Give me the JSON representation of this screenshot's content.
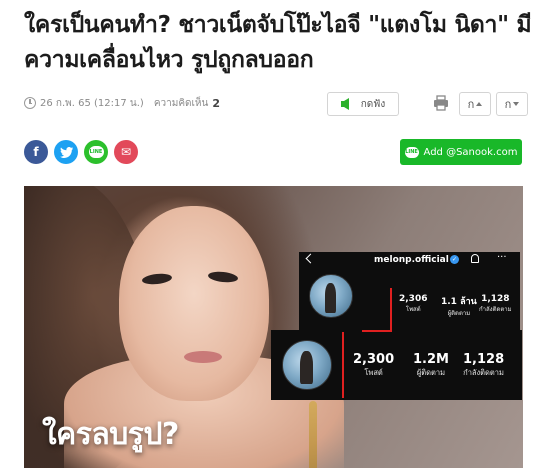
{
  "article": {
    "title": "ใครเป็นคนทำ? ชาวเน็ตจับโป๊ะไอจี \"แตงโม นิดา\" มีความเคลื่อนไหว รูปถูกลบออก",
    "date": "26 ก.พ. 65 (12:17 น.)",
    "comment_label": "ความคิดเห็น",
    "comment_count": "2"
  },
  "toolbar": {
    "listen_label": "กดฟัง",
    "font_up_label": "ก",
    "font_down_label": "ก"
  },
  "share": {
    "facebook": "f",
    "twitter": "t",
    "line": "LINE",
    "mail": "✉",
    "add_label": "Add @Sanook.com",
    "line_icon_text": "LINE"
  },
  "hero": {
    "caption": "ใครลบรูป?",
    "ig_top": {
      "username": "melonp.official",
      "posts": "2,306",
      "posts_label": "โพสต์",
      "followers": "1.1 ล้าน",
      "followers_label": "ผู้ติดตาม",
      "following": "1,128",
      "following_label": "กำลังติดตาม"
    },
    "ig_bottom": {
      "posts": "2,300",
      "posts_label": "โพสต์",
      "followers": "1.2M",
      "followers_label": "ผู้ติดตาม",
      "following": "1,128",
      "following_label": "กำลังติดตาม"
    }
  },
  "colors": {
    "facebook": "#3b5998",
    "twitter": "#1da1f2",
    "line": "#2cc02c",
    "mail": "#e2495a",
    "add_line": "#19b829",
    "highlight": "#e02020"
  }
}
